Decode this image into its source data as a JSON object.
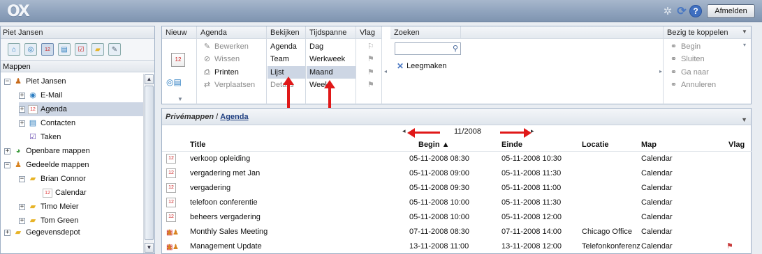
{
  "app": {
    "logo": "OX",
    "logout_label": "Afmelden"
  },
  "left": {
    "user_header": "Piet Jansen",
    "module_icons": [
      "mail-icon",
      "contacts-icon",
      "calendar-icon",
      "tasks-icon",
      "infostore-icon",
      "folder-icon",
      "settings-icon"
    ],
    "mappen_header": "Mappen",
    "tree": [
      {
        "label": "Piet Jansen"
      },
      {
        "label": "E-Mail"
      },
      {
        "label": "Agenda"
      },
      {
        "label": "Contacten"
      },
      {
        "label": "Taken"
      },
      {
        "label": "Openbare mappen"
      },
      {
        "label": "Gedeelde mappen"
      },
      {
        "label": "Brian Connor"
      },
      {
        "label": "Calendar"
      },
      {
        "label": "Timo Meier"
      },
      {
        "label": "Tom Green"
      },
      {
        "label": "Gegevensdepot"
      }
    ]
  },
  "toolbar": {
    "nieuw": {
      "header": "Nieuw"
    },
    "agenda": {
      "header": "Agenda",
      "items": [
        "Bewerken",
        "Wissen",
        "Printen",
        "Verplaatsen"
      ]
    },
    "bekijken": {
      "header": "Bekijken",
      "items": [
        "Agenda",
        "Team",
        "Lijst",
        "Details"
      ]
    },
    "tijdspanne": {
      "header": "Tijdspanne",
      "items": [
        "Dag",
        "Werkweek",
        "Maand",
        "Week"
      ]
    },
    "vlag": {
      "header": "Vlag"
    },
    "zoeken": {
      "header": "Zoeken",
      "clear_label": "Leegmaken"
    },
    "koppelen": {
      "header": "Bezig te koppelen",
      "items": [
        "Begin",
        "Sluiten",
        "Ga naar",
        "Annuleren"
      ]
    }
  },
  "grid": {
    "breadcrumb_parent": "Privémappen",
    "breadcrumb_sep": " / ",
    "breadcrumb_current": "Agenda",
    "month_label": "11/2008",
    "columns": {
      "title": "Title",
      "begin": "Begin ▲",
      "einde": "Einde",
      "locatie": "Locatie",
      "map": "Map",
      "vlag": "Vlag"
    },
    "rows": [
      {
        "title": "verkoop opleiding",
        "begin": "05-11-2008 08:30",
        "einde": "05-11-2008 10:30",
        "locatie": "",
        "map": "Calendar",
        "group": false,
        "flag": false
      },
      {
        "title": "vergadering met Jan",
        "begin": "05-11-2008 09:00",
        "einde": "05-11-2008 11:30",
        "locatie": "",
        "map": "Calendar",
        "group": false,
        "flag": false
      },
      {
        "title": "vergadering",
        "begin": "05-11-2008 09:30",
        "einde": "05-11-2008 11:00",
        "locatie": "",
        "map": "Calendar",
        "group": false,
        "flag": false
      },
      {
        "title": "telefoon conferentie",
        "begin": "05-11-2008 10:00",
        "einde": "05-11-2008 11:30",
        "locatie": "",
        "map": "Calendar",
        "group": false,
        "flag": false
      },
      {
        "title": "beheers vergadering",
        "begin": "05-11-2008 10:00",
        "einde": "05-11-2008 12:00",
        "locatie": "",
        "map": "Calendar",
        "group": false,
        "flag": false
      },
      {
        "title": "Monthly Sales Meeting",
        "begin": "07-11-2008 08:30",
        "einde": "07-11-2008 14:00",
        "locatie": "Chicago Office",
        "map": "Calendar",
        "group": true,
        "flag": false
      },
      {
        "title": "Management Update",
        "begin": "13-11-2008 11:00",
        "einde": "13-11-2008 12:00",
        "locatie": "Telefonkonferenz",
        "map": "Calendar",
        "group": true,
        "flag": true
      }
    ]
  },
  "colors": {
    "annotation_arrow": "#e01818",
    "selection": "#cdd6e4",
    "link": "#1f3f80"
  }
}
